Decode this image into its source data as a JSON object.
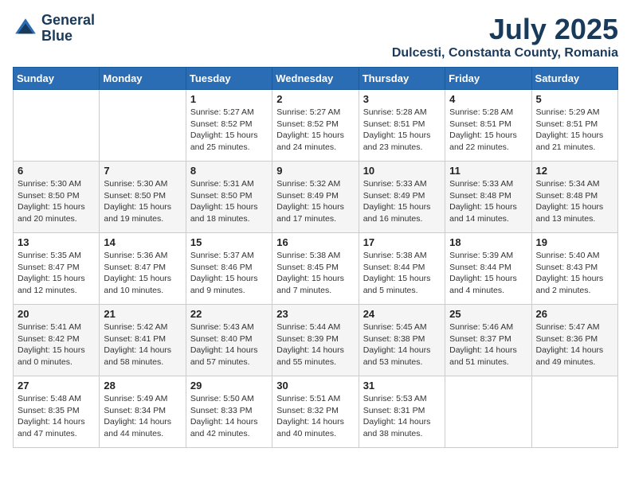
{
  "logo": {
    "line1": "General",
    "line2": "Blue"
  },
  "title": "July 2025",
  "location": "Dulcesti, Constanta County, Romania",
  "days_of_week": [
    "Sunday",
    "Monday",
    "Tuesday",
    "Wednesday",
    "Thursday",
    "Friday",
    "Saturday"
  ],
  "weeks": [
    [
      {
        "day": "",
        "info": ""
      },
      {
        "day": "",
        "info": ""
      },
      {
        "day": "1",
        "info": "Sunrise: 5:27 AM\nSunset: 8:52 PM\nDaylight: 15 hours\nand 25 minutes."
      },
      {
        "day": "2",
        "info": "Sunrise: 5:27 AM\nSunset: 8:52 PM\nDaylight: 15 hours\nand 24 minutes."
      },
      {
        "day": "3",
        "info": "Sunrise: 5:28 AM\nSunset: 8:51 PM\nDaylight: 15 hours\nand 23 minutes."
      },
      {
        "day": "4",
        "info": "Sunrise: 5:28 AM\nSunset: 8:51 PM\nDaylight: 15 hours\nand 22 minutes."
      },
      {
        "day": "5",
        "info": "Sunrise: 5:29 AM\nSunset: 8:51 PM\nDaylight: 15 hours\nand 21 minutes."
      }
    ],
    [
      {
        "day": "6",
        "info": "Sunrise: 5:30 AM\nSunset: 8:50 PM\nDaylight: 15 hours\nand 20 minutes."
      },
      {
        "day": "7",
        "info": "Sunrise: 5:30 AM\nSunset: 8:50 PM\nDaylight: 15 hours\nand 19 minutes."
      },
      {
        "day": "8",
        "info": "Sunrise: 5:31 AM\nSunset: 8:50 PM\nDaylight: 15 hours\nand 18 minutes."
      },
      {
        "day": "9",
        "info": "Sunrise: 5:32 AM\nSunset: 8:49 PM\nDaylight: 15 hours\nand 17 minutes."
      },
      {
        "day": "10",
        "info": "Sunrise: 5:33 AM\nSunset: 8:49 PM\nDaylight: 15 hours\nand 16 minutes."
      },
      {
        "day": "11",
        "info": "Sunrise: 5:33 AM\nSunset: 8:48 PM\nDaylight: 15 hours\nand 14 minutes."
      },
      {
        "day": "12",
        "info": "Sunrise: 5:34 AM\nSunset: 8:48 PM\nDaylight: 15 hours\nand 13 minutes."
      }
    ],
    [
      {
        "day": "13",
        "info": "Sunrise: 5:35 AM\nSunset: 8:47 PM\nDaylight: 15 hours\nand 12 minutes."
      },
      {
        "day": "14",
        "info": "Sunrise: 5:36 AM\nSunset: 8:47 PM\nDaylight: 15 hours\nand 10 minutes."
      },
      {
        "day": "15",
        "info": "Sunrise: 5:37 AM\nSunset: 8:46 PM\nDaylight: 15 hours\nand 9 minutes."
      },
      {
        "day": "16",
        "info": "Sunrise: 5:38 AM\nSunset: 8:45 PM\nDaylight: 15 hours\nand 7 minutes."
      },
      {
        "day": "17",
        "info": "Sunrise: 5:38 AM\nSunset: 8:44 PM\nDaylight: 15 hours\nand 5 minutes."
      },
      {
        "day": "18",
        "info": "Sunrise: 5:39 AM\nSunset: 8:44 PM\nDaylight: 15 hours\nand 4 minutes."
      },
      {
        "day": "19",
        "info": "Sunrise: 5:40 AM\nSunset: 8:43 PM\nDaylight: 15 hours\nand 2 minutes."
      }
    ],
    [
      {
        "day": "20",
        "info": "Sunrise: 5:41 AM\nSunset: 8:42 PM\nDaylight: 15 hours\nand 0 minutes."
      },
      {
        "day": "21",
        "info": "Sunrise: 5:42 AM\nSunset: 8:41 PM\nDaylight: 14 hours\nand 58 minutes."
      },
      {
        "day": "22",
        "info": "Sunrise: 5:43 AM\nSunset: 8:40 PM\nDaylight: 14 hours\nand 57 minutes."
      },
      {
        "day": "23",
        "info": "Sunrise: 5:44 AM\nSunset: 8:39 PM\nDaylight: 14 hours\nand 55 minutes."
      },
      {
        "day": "24",
        "info": "Sunrise: 5:45 AM\nSunset: 8:38 PM\nDaylight: 14 hours\nand 53 minutes."
      },
      {
        "day": "25",
        "info": "Sunrise: 5:46 AM\nSunset: 8:37 PM\nDaylight: 14 hours\nand 51 minutes."
      },
      {
        "day": "26",
        "info": "Sunrise: 5:47 AM\nSunset: 8:36 PM\nDaylight: 14 hours\nand 49 minutes."
      }
    ],
    [
      {
        "day": "27",
        "info": "Sunrise: 5:48 AM\nSunset: 8:35 PM\nDaylight: 14 hours\nand 47 minutes."
      },
      {
        "day": "28",
        "info": "Sunrise: 5:49 AM\nSunset: 8:34 PM\nDaylight: 14 hours\nand 44 minutes."
      },
      {
        "day": "29",
        "info": "Sunrise: 5:50 AM\nSunset: 8:33 PM\nDaylight: 14 hours\nand 42 minutes."
      },
      {
        "day": "30",
        "info": "Sunrise: 5:51 AM\nSunset: 8:32 PM\nDaylight: 14 hours\nand 40 minutes."
      },
      {
        "day": "31",
        "info": "Sunrise: 5:53 AM\nSunset: 8:31 PM\nDaylight: 14 hours\nand 38 minutes."
      },
      {
        "day": "",
        "info": ""
      },
      {
        "day": "",
        "info": ""
      }
    ]
  ]
}
